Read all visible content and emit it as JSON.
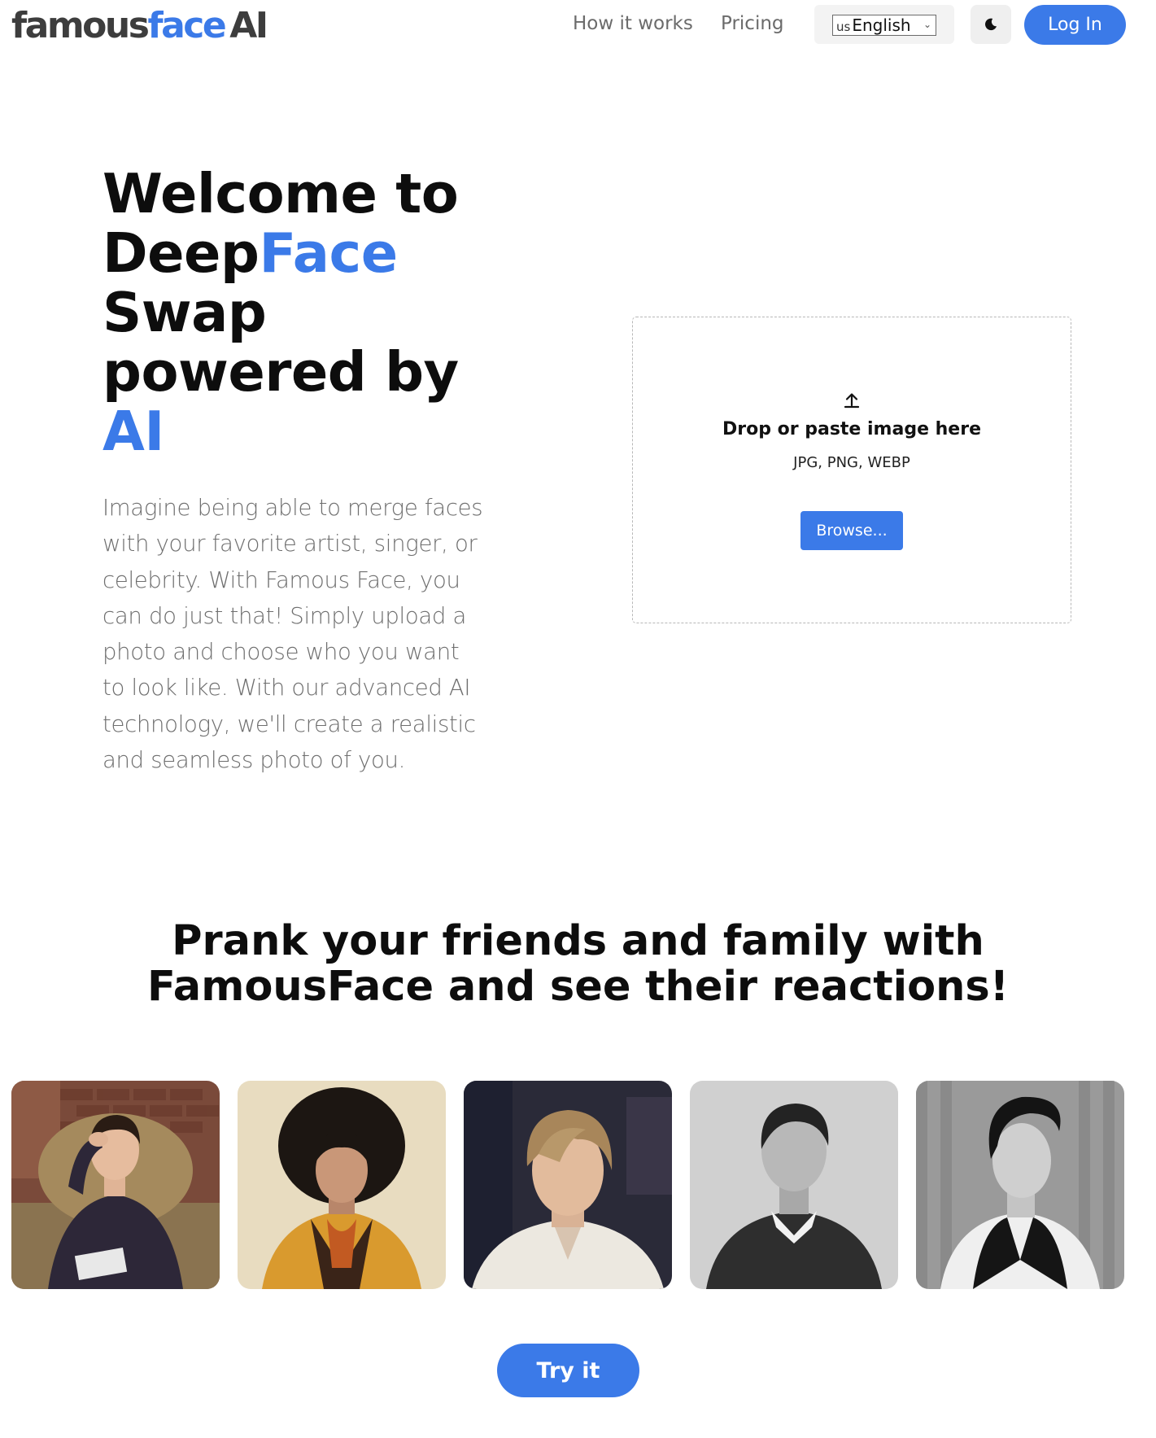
{
  "header": {
    "logo": {
      "part1": "famous",
      "part2": "face",
      "part3": "AI"
    },
    "nav": {
      "how_it_works": "How it works",
      "pricing": "Pricing"
    },
    "language": {
      "flag": "us",
      "selected": "English"
    },
    "theme_icon": "moon-icon",
    "login_label": "Log In"
  },
  "hero": {
    "title_line1": "Welcome to",
    "title_deep": "Deep",
    "title_face": "Face",
    "title_line3": "Swap",
    "title_line4": "powered by",
    "title_ai": "AI",
    "description": "Imagine being able to merge faces with your favorite artist, singer, or celebrity. With Famous Face, you can do just that! Simply upload a photo and choose who you want to look like. With our advanced AI technology, we'll create a realistic and seamless photo of you."
  },
  "upload": {
    "icon": "upload-icon",
    "title": "Drop or paste image here",
    "formats": "JPG, PNG, WEBP",
    "browse_label": "Browse..."
  },
  "prank": {
    "title_line1": "Prank your friends and family with",
    "title_line2": "FamousFace and see their reactions!"
  },
  "try_label": "Try it",
  "colors": {
    "accent": "#3b7ae8",
    "text_dark": "#0d0d0d",
    "text_muted": "#6e6e6e"
  }
}
